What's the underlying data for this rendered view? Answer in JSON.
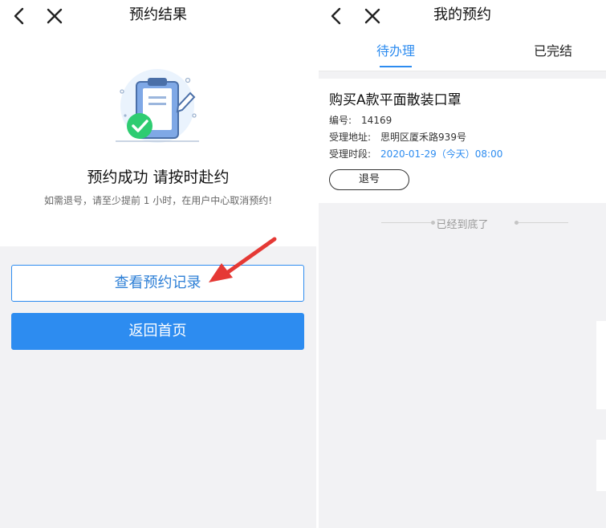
{
  "left": {
    "nav": {
      "title": "预约结果",
      "back_icon": "chevron-left-icon",
      "close_icon": "close-icon"
    },
    "result": {
      "icon": "clipboard-check-icon",
      "title": "预约成功 请按时赴约",
      "note": "如需退号，请至少提前 1 小时，在用户中心取消预约!"
    },
    "buttons": {
      "view_records": "查看预约记录",
      "back_home": "返回首页"
    },
    "annotation": {
      "icon": "red-arrow-icon",
      "color": "#e53935"
    }
  },
  "right": {
    "nav": {
      "title": "我的预约",
      "back_icon": "chevron-left-icon",
      "close_icon": "close-icon"
    },
    "tabs": [
      {
        "label": "待办理",
        "active": true
      },
      {
        "label": "已完结",
        "active": false
      }
    ],
    "appointment": {
      "title": "购买A款平面散装口罩",
      "number_label": "编号:",
      "number": "14169",
      "address_label": "受理地址:",
      "address": "思明区厦禾路939号",
      "time_label": "受理时段:",
      "time": "2020-01-29（今天）08:00",
      "cancel_label": "退号"
    },
    "end_text": "已经到底了"
  },
  "colors": {
    "primary": "#2d8cf0",
    "success": "#2ecc71",
    "background": "#f2f2f4",
    "annotation": "#e53935"
  }
}
